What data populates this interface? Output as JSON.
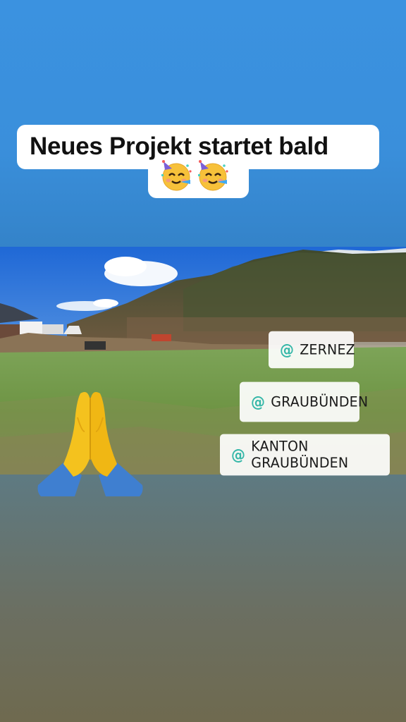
{
  "story": {
    "title": "Neues Projekt startet bald",
    "emoji_icons": [
      "partying-face-icon",
      "partying-face-icon"
    ],
    "hands_icon": "folded-hands-icon"
  },
  "tags": [
    {
      "at": "@",
      "label": "ZERNEZ"
    },
    {
      "at": "@",
      "label": "GRAUBÜNDEN"
    },
    {
      "at": "@",
      "label": "KANTON GRAUBÜNDEN"
    }
  ],
  "colors": {
    "sky_top": "#3b92e0",
    "mention_accent": "#35b7a8",
    "bottom_gradient_end": "#6f6a4f"
  }
}
